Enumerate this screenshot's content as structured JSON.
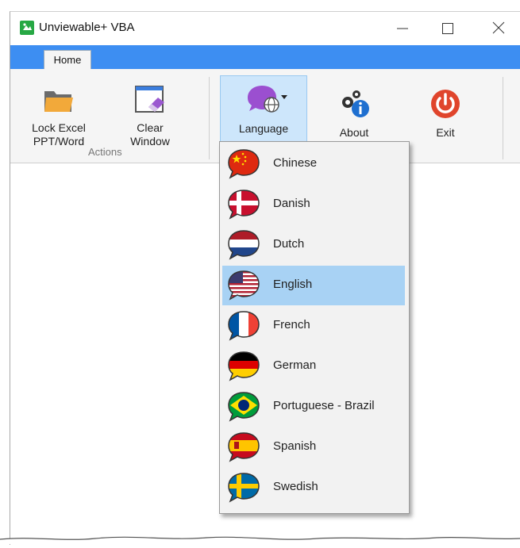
{
  "window": {
    "title": "Unviewable+ VBA"
  },
  "tabs": [
    {
      "label": "Home"
    }
  ],
  "ribbon": {
    "lock_label_1": "Lock Excel",
    "lock_label_2": "PPT/Word",
    "clear_label_1": "Clear",
    "clear_label_2": "Window",
    "group_label": "Actions",
    "language_label": "Language",
    "about_label": "About",
    "exit_label": "Exit"
  },
  "language_menu": {
    "selected": "English",
    "items": [
      {
        "label": "Chinese",
        "flag": "china-flag-icon"
      },
      {
        "label": "Danish",
        "flag": "denmark-flag-icon"
      },
      {
        "label": "Dutch",
        "flag": "netherlands-flag-icon"
      },
      {
        "label": "English",
        "flag": "usa-flag-icon"
      },
      {
        "label": "French",
        "flag": "france-flag-icon"
      },
      {
        "label": "German",
        "flag": "germany-flag-icon"
      },
      {
        "label": "Portuguese - Brazil",
        "flag": "brazil-flag-icon"
      },
      {
        "label": "Spanish",
        "flag": "spain-flag-icon"
      },
      {
        "label": "Swedish",
        "flag": "sweden-flag-icon"
      }
    ]
  },
  "colors": {
    "ribbon_tab_bar": "#3d8ef2",
    "selection": "#a8d2f4",
    "exit_red": "#e0452c"
  }
}
